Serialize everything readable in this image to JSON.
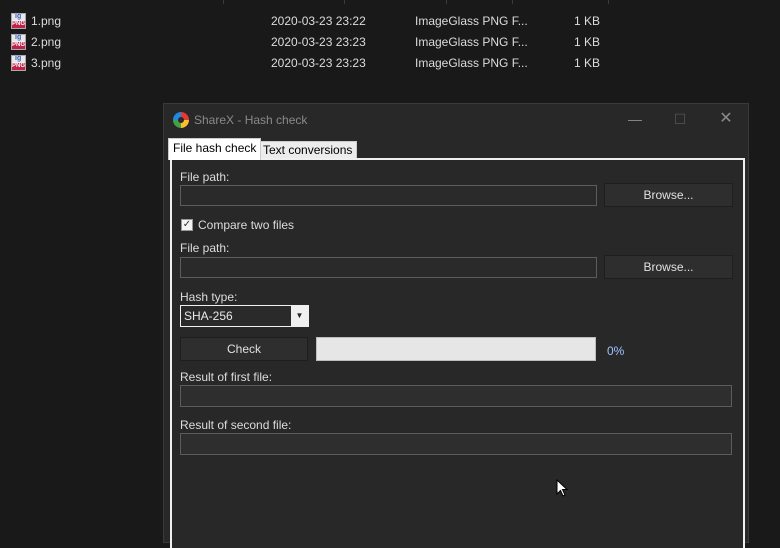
{
  "files": [
    {
      "name": "1.png",
      "date": "2020-03-23 23:22",
      "type": "ImageGlass PNG F...",
      "size": "1 KB",
      "icon": "imageglass-png-icon"
    },
    {
      "name": "2.png",
      "date": "2020-03-23 23:23",
      "type": "ImageGlass PNG F...",
      "size": "1 KB",
      "icon": "imageglass-png-icon"
    },
    {
      "name": "3.png",
      "date": "2020-03-23 23:23",
      "type": "ImageGlass PNG F...",
      "size": "1 KB",
      "icon": "imageglass-png-icon"
    }
  ],
  "window": {
    "title": "ShareX - Hash check",
    "minimize": "—",
    "maximize": "☐",
    "close": "✕"
  },
  "tabs": [
    {
      "label": "File hash check",
      "active": true
    },
    {
      "label": "Text conversions",
      "active": false
    }
  ],
  "form": {
    "file_path_label": "File path:",
    "file_path_value": "",
    "browse_label": "Browse...",
    "compare_label": "Compare two files",
    "compare_checked": true,
    "file_path2_label": "File path:",
    "file_path2_value": "",
    "browse2_label": "Browse...",
    "hash_type_label": "Hash type:",
    "hash_type_value": "SHA-256",
    "check_label": "Check",
    "progress_percent": 0,
    "progress_text": "0%",
    "result1_label": "Result of first file:",
    "result1_value": "",
    "result2_label": "Result of second file:",
    "result2_value": ""
  },
  "colors": {
    "accent_text": "#9ec4ff",
    "window_bg": "#282828",
    "progress_bg": "#e6e6e6"
  }
}
